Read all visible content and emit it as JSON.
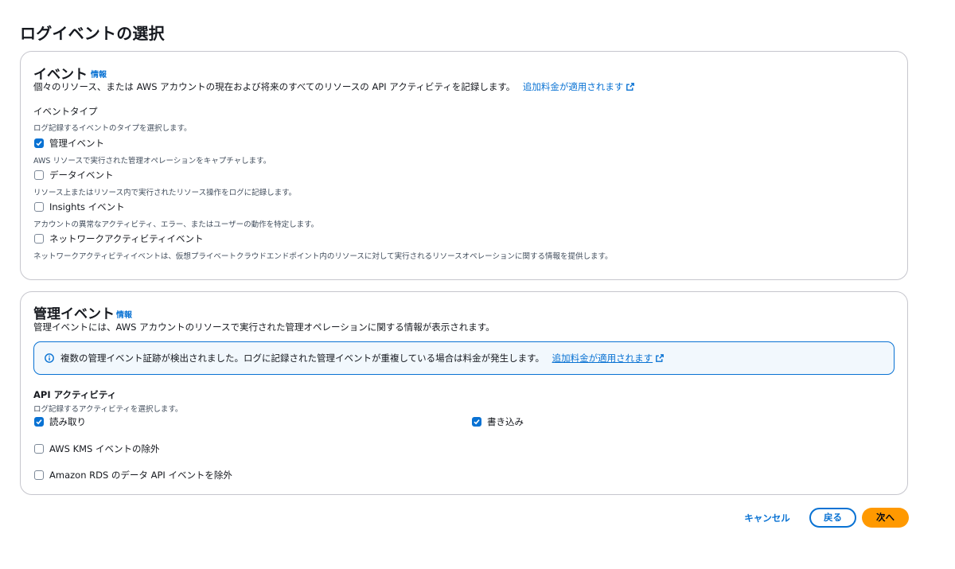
{
  "page": {
    "title": "ログイベントの選択"
  },
  "events_section": {
    "title": "イベント",
    "info": "情報",
    "description": "個々のリソース、または AWS アカウントの現在および将来のすべてのリソースの API アクティビティを記録します。",
    "pricing_link": "追加料金が適用されます",
    "event_type_label": "イベントタイプ",
    "event_type_help": "ログ記録するイベントのタイプを選択します。",
    "options": [
      {
        "label": "管理イベント",
        "help": "AWS リソースで実行された管理オペレーションをキャプチャします。",
        "checked": true
      },
      {
        "label": "データイベント",
        "help": "リソース上またはリソース内で実行されたリソース操作をログに記録します。",
        "checked": false
      },
      {
        "label": "Insights イベント",
        "help": "アカウントの異常なアクティビティ、エラー、またはユーザーの動作を特定します。",
        "checked": false
      },
      {
        "label": "ネットワークアクティビティイベント",
        "help": "ネットワークアクティビティイベントは、仮想プライベートクラウドエンドポイント内のリソースに対して実行されるリソースオペレーションに関する情報を提供します。",
        "checked": false
      }
    ]
  },
  "mgmt_section": {
    "title": "管理イベント",
    "info": "情報",
    "description": "管理イベントには、AWS アカウントのリソースで実行された管理オペレーションに関する情報が表示されます。",
    "alert_text": "複数の管理イベント証跡が検出されました。ログに記録された管理イベントが重複している場合は料金が発生します。",
    "alert_link": "追加料金が適用されます",
    "api_label": "API アクティビティ",
    "api_help": "ログ記録するアクティビティを選択します。",
    "read_label": "読み取り",
    "read_checked": true,
    "write_label": "書き込み",
    "write_checked": true,
    "kms_label": "AWS KMS イベントの除外",
    "kms_checked": false,
    "rds_label": "Amazon RDS のデータ API イベントを除外",
    "rds_checked": false
  },
  "footer": {
    "cancel": "キャンセル",
    "back": "戻る",
    "next": "次へ"
  },
  "colors": {
    "accent": "#0972d3",
    "primary_button": "#ff9900",
    "alert_bg": "#f2f8fd"
  }
}
